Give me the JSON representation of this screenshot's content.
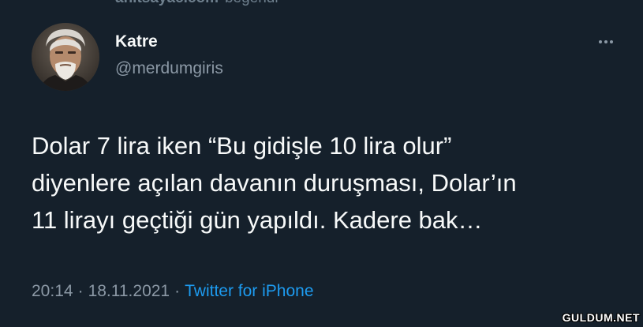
{
  "top_context": {
    "account": "anitsayac.com",
    "action": "beğendi"
  },
  "tweet": {
    "author_name": "Katre",
    "author_handle": "@merdumgiris",
    "text_lines": [
      "Dolar 7 lira iken “Bu gidişle 10 lira olur”",
      "diyenlere açılan davanın duruşması, Dolar’ın",
      "11 lirayı geçtiği gün yapıldı. Kadere bak…"
    ],
    "time": "20:14",
    "date": "18.11.2021",
    "separator": "·",
    "source": "Twitter for iPhone",
    "more_icon": "more-horizontal-icon",
    "avatar": "avatar-photo"
  },
  "watermark": "GULDUM.NET",
  "colors": {
    "background": "#15202b",
    "text_primary": "#f7f9f9",
    "text_secondary": "#8b98a5",
    "link": "#1d9bf0"
  }
}
